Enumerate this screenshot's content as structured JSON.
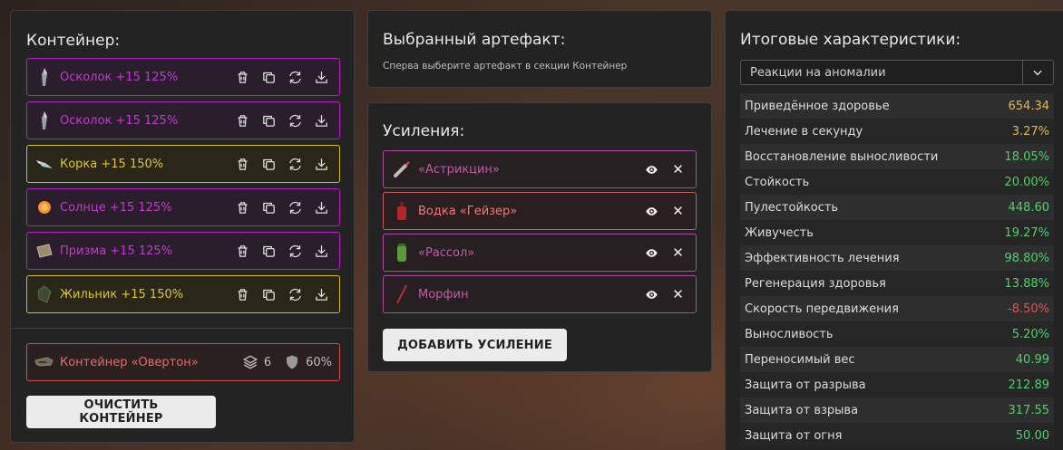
{
  "container": {
    "title": "Контейнер:",
    "artifacts": [
      {
        "label": "Осколок +15 125%",
        "color": "purple",
        "icon": "shard-icon"
      },
      {
        "label": "Осколок +15 125%",
        "color": "purple",
        "icon": "shard-icon"
      },
      {
        "label": "Корка +15 150%",
        "color": "gold",
        "icon": "crust-icon"
      },
      {
        "label": "Солнце +15 125%",
        "color": "purple",
        "icon": "sun-icon"
      },
      {
        "label": "Призма +15 125%",
        "color": "purple",
        "icon": "prism-icon"
      },
      {
        "label": "Жильник +15 150%",
        "color": "gold",
        "icon": "vein-icon"
      }
    ],
    "holder": {
      "label": "Контейнер «Овертон»",
      "slots": "6",
      "protection": "60%"
    },
    "clear_label": "ОЧИСТИТЬ КОНТЕЙНЕР"
  },
  "selected": {
    "title": "Выбранный артефакт:",
    "hint": "Сперва выберите артефакт в секции Контейнер"
  },
  "boosts": {
    "title": "Усиления:",
    "items": [
      {
        "label": "«Астрикцин»",
        "color": "purple",
        "icon": "syringe-icon"
      },
      {
        "label": "Водка «Гейзер»",
        "color": "red",
        "icon": "bottle-icon"
      },
      {
        "label": "«Рассол»",
        "color": "purple",
        "icon": "jar-icon"
      },
      {
        "label": "Морфин",
        "color": "purple",
        "icon": "needle-icon"
      }
    ],
    "add_label": "ДОБАВИТЬ УСИЛЕНИЕ"
  },
  "stats": {
    "title": "Итоговые характеристики:",
    "select_value": "Реакции на аномалии",
    "rows": [
      {
        "name": "Приведённое здоровье",
        "value": "654.34",
        "color": "#e0b84a"
      },
      {
        "name": "Лечение в секунду",
        "value": "3.27%",
        "color": "#e0b84a"
      },
      {
        "name": "Восстановление выносливости",
        "value": "18.05%",
        "color": "#4fd16a"
      },
      {
        "name": "Стойкость",
        "value": "20.00%",
        "color": "#4fd16a"
      },
      {
        "name": "Пулестойкость",
        "value": "448.60",
        "color": "#4fd16a"
      },
      {
        "name": "Живучесть",
        "value": "19.27%",
        "color": "#4fd16a"
      },
      {
        "name": "Эффективность лечения",
        "value": "98.80%",
        "color": "#4fd16a"
      },
      {
        "name": "Регенерация здоровья",
        "value": "13.88%",
        "color": "#4fd16a"
      },
      {
        "name": "Скорость передвижения",
        "value": "-8.50%",
        "color": "#e05555"
      },
      {
        "name": "Выносливость",
        "value": "5.20%",
        "color": "#4fd16a"
      },
      {
        "name": "Переносимый вес",
        "value": "40.99",
        "color": "#4fd16a"
      },
      {
        "name": "Защита от разрыва",
        "value": "212.89",
        "color": "#4fd16a"
      },
      {
        "name": "Защита от взрыва",
        "value": "317.55",
        "color": "#4fd16a"
      },
      {
        "name": "Защита от огня",
        "value": "50.00",
        "color": "#4fd16a"
      }
    ]
  }
}
